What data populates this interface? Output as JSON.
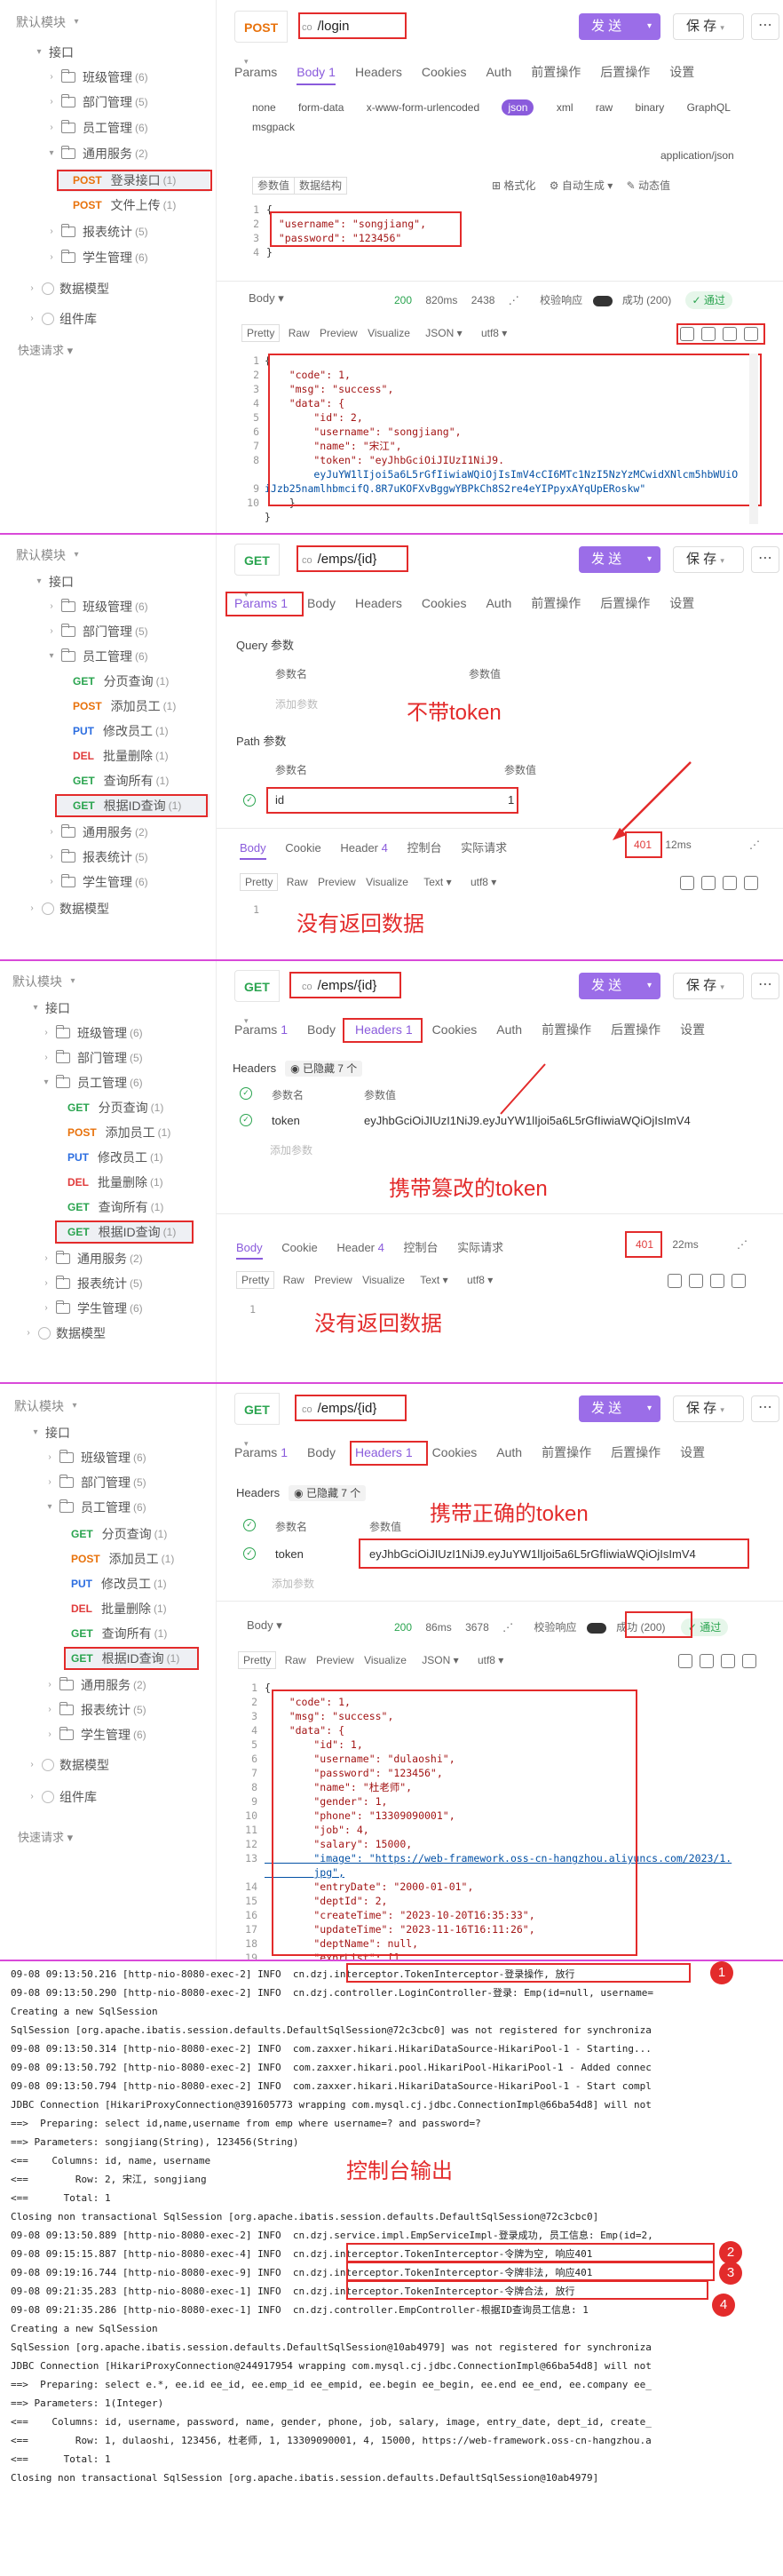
{
  "sidebar": {
    "default_module": "默认模块",
    "interface": "接口",
    "class_mgmt": "班级管理",
    "class_cnt": "(6)",
    "dept_mgmt": "部门管理",
    "dept_cnt": "(5)",
    "emp_mgmt": "员工管理",
    "emp_cnt": "(6)",
    "common": "通用服务",
    "common_cnt": "(2)",
    "login": "登录接口",
    "login_cnt": "(1)",
    "upload": "文件上传",
    "upload_cnt": "(1)",
    "report": "报表统计",
    "report_cnt": "(5)",
    "student": "学生管理",
    "student_cnt": "(6)",
    "datamodel": "数据模型",
    "component": "组件库",
    "quick": "快速请求",
    "emp_items": [
      {
        "method": "GET",
        "label": "分页查询",
        "cnt": "(1)"
      },
      {
        "method": "POST",
        "label": "添加员工",
        "cnt": "(1)"
      },
      {
        "method": "PUT",
        "label": "修改员工",
        "cnt": "(1)"
      },
      {
        "method": "DEL",
        "label": "批量删除",
        "cnt": "(1)"
      },
      {
        "method": "GET",
        "label": "查询所有",
        "cnt": "(1)"
      },
      {
        "method": "GET",
        "label": "根据ID查询",
        "cnt": "(1)"
      }
    ]
  },
  "common_ui": {
    "send": "发 送",
    "save": "保 存",
    "more": "⋯",
    "tabs": [
      "Params",
      "Body",
      "Headers",
      "Cookies",
      "Auth",
      "前置操作",
      "后置操作",
      "设置"
    ],
    "tab_count": "1",
    "resp_tabs": [
      "Body",
      "Cookie",
      "Header",
      "控制台",
      "实际请求"
    ],
    "header_count": "4",
    "view_modes": [
      "Pretty",
      "Raw",
      "Preview",
      "Visualize"
    ],
    "enc": "utf8",
    "verify": "校验响应",
    "pass": "✓ 通过",
    "param_name": "参数名",
    "param_value": "参数值",
    "add_param": "添加参数"
  },
  "panel1": {
    "method": "POST",
    "url": "/login",
    "env": "co",
    "body_types": [
      "none",
      "form-data",
      "x-www-form-urlencoded",
      "json",
      "xml",
      "raw",
      "binary",
      "GraphQL",
      "msgpack"
    ],
    "content_type": "application/json",
    "tools": [
      "参数值",
      "数据结构"
    ],
    "tools_right": [
      "格式化",
      "自动生成",
      "动态值"
    ],
    "request_lines": [
      "{",
      "  \"username\": \"songjiang\",",
      "  \"password\": \"123456\"",
      "}"
    ],
    "status": "200",
    "time": "820ms",
    "size": "2438",
    "success": "成功 (200)",
    "resp_format": "JSON",
    "resp_lines": [
      "{",
      "    \"code\": 1,",
      "    \"msg\": \"success\",",
      "    \"data\": {",
      "        \"id\": 2,",
      "        \"username\": \"songjiang\",",
      "        \"name\": \"宋江\",",
      "        \"token\": \"eyJhbGciOiJIUzI1NiJ9.",
      "        eyJuYW1lIjoi5a6L5rGfIiwiaWQiOjIsImV4cCI6MTc1NzI5NzYzMCwidXNlcm5hbWUiOiJzb25namlhbmcifQ.8R7uKOFXvBggwYBPkCh8S2re4eYIPpyxAYqUpERoskw\"",
      "    }",
      "}"
    ]
  },
  "panel2": {
    "method": "GET",
    "url": "/emps/{id}",
    "query_label": "Query 参数",
    "path_label": "Path 参数",
    "path_name": "id",
    "path_value": "1",
    "annot_token": "不带token",
    "status": "401",
    "time": "12ms",
    "resp_format": "Text",
    "annot_resp": "没有返回数据"
  },
  "panel3": {
    "method": "GET",
    "url": "/emps/{id}",
    "headers_label": "Headers",
    "hidden": "已隐藏 7 个",
    "h_name": "token",
    "h_value": "eyJhbGciOiJIUzI1NiJ9.eyJuYW1lIjoi5a6L5rGfIiwiaWQiOjIsImV4",
    "annot_token": "携带篡改的token",
    "status": "401",
    "time": "22ms",
    "resp_format": "Text",
    "annot_resp": "没有返回数据"
  },
  "panel4": {
    "method": "GET",
    "url": "/emps/{id}",
    "headers_label": "Headers",
    "hidden": "已隐藏 7 个",
    "h_name": "token",
    "h_value": "eyJhbGciOiJIUzI1NiJ9.eyJuYW1lIjoi5a6L5rGfIiwiaWQiOjIsImV4",
    "annot_token": "携带正确的token",
    "status": "200",
    "time": "86ms",
    "size": "3678",
    "success": "成功 (200)",
    "resp_format": "JSON",
    "resp_lines": [
      "{",
      "    \"code\": 1,",
      "    \"msg\": \"success\",",
      "    \"data\": {",
      "        \"id\": 1,",
      "        \"username\": \"dulaoshi\",",
      "        \"password\": \"123456\",",
      "        \"name\": \"杜老师\",",
      "        \"gender\": 1,",
      "        \"phone\": \"13309090001\",",
      "        \"job\": 4,",
      "        \"salary\": 15000,",
      "        \"image\": \"https://web-framework.oss-cn-hangzhou.aliyuncs.com/2023/1.",
      "        jpg\",",
      "        \"entryDate\": \"2000-01-01\",",
      "        \"deptId\": 2,",
      "        \"createTime\": \"2023-10-20T16:35:33\",",
      "        \"updateTime\": \"2023-11-16T16:11:26\",",
      "        \"deptName\": null,",
      "        \"exprList\": []",
      "    }",
      "}"
    ]
  },
  "console": {
    "annot": "控制台输出",
    "lines": [
      "09-08 09:13:50.216 [http-nio-8080-exec-2] INFO  cn.dzj.interceptor.TokenInterceptor-登录操作, 放行",
      "09-08 09:13:50.290 [http-nio-8080-exec-2] INFO  cn.dzj.controller.LoginController-登录: Emp(id=null, username=",
      "Creating a new SqlSession",
      "SqlSession [org.apache.ibatis.session.defaults.DefaultSqlSession@72c3cbc0] was not registered for synchroniza",
      "09-08 09:13:50.314 [http-nio-8080-exec-2] INFO  com.zaxxer.hikari.HikariDataSource-HikariPool-1 - Starting...",
      "09-08 09:13:50.792 [http-nio-8080-exec-2] INFO  com.zaxxer.hikari.pool.HikariPool-HikariPool-1 - Added connec",
      "09-08 09:13:50.794 [http-nio-8080-exec-2] INFO  com.zaxxer.hikari.HikariDataSource-HikariPool-1 - Start compl",
      "JDBC Connection [HikariProxyConnection@391605773 wrapping com.mysql.cj.jdbc.ConnectionImpl@66ba54d8] will not",
      "==>  Preparing: select id,name,username from emp where username=? and password=?",
      "==> Parameters: songjiang(String), 123456(String)",
      "<==    Columns: id, name, username",
      "<==        Row: 2, 宋江, songjiang",
      "<==      Total: 1",
      "Closing non transactional SqlSession [org.apache.ibatis.session.defaults.DefaultSqlSession@72c3cbc0]",
      "09-08 09:13:50.889 [http-nio-8080-exec-2] INFO  cn.dzj.service.impl.EmpServiceImpl-登录成功, 员工信息: Emp(id=2,",
      "09-08 09:15:15.887 [http-nio-8080-exec-4] INFO  cn.dzj.interceptor.TokenInterceptor-令牌为空, 响应401",
      "09-08 09:19:16.744 [http-nio-8080-exec-9] INFO  cn.dzj.interceptor.TokenInterceptor-令牌非法, 响应401",
      "09-08 09:21:35.283 [http-nio-8080-exec-1] INFO  cn.dzj.interceptor.TokenInterceptor-令牌合法, 放行",
      "09-08 09:21:35.286 [http-nio-8080-exec-1] INFO  cn.dzj.controller.EmpController-根据ID查询员工信息: 1",
      "Creating a new SqlSession",
      "SqlSession [org.apache.ibatis.session.defaults.DefaultSqlSession@10ab4979] was not registered for synchroniza",
      "JDBC Connection [HikariProxyConnection@244917954 wrapping com.mysql.cj.jdbc.ConnectionImpl@66ba54d8] will not",
      "==>  Preparing: select e.*, ee.id ee_id, ee.emp_id ee_empid, ee.begin ee_begin, ee.end ee_end, ee.company ee_",
      "==> Parameters: 1(Integer)",
      "<==    Columns: id, username, password, name, gender, phone, job, salary, image, entry_date, dept_id, create_",
      "<==        Row: 1, dulaoshi, 123456, 杜老师, 1, 13309090001, 4, 15000, https://web-framework.oss-cn-hangzhou.a",
      "<==      Total: 1",
      "Closing non transactional SqlSession [org.apache.ibatis.session.defaults.DefaultSqlSession@10ab4979]"
    ],
    "badges": [
      "1",
      "2",
      "3",
      "4"
    ]
  }
}
